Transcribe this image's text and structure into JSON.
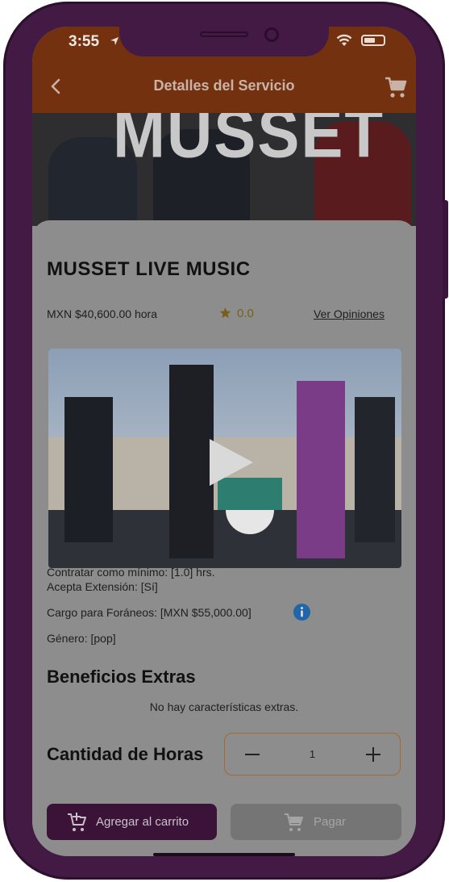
{
  "status_bar": {
    "time": "3:55"
  },
  "header": {
    "title": "Detalles del Servicio"
  },
  "hero": {
    "text": "MUSSET"
  },
  "service": {
    "title": "MUSSET LIVE MUSIC",
    "price": "MXN $40,600.00 hora",
    "rating": "0.0",
    "opinions_link": "Ver Opiniones"
  },
  "details": {
    "min_hire": "Contratar como mínimo: [1.0] hrs.",
    "extension": "Acepta Extensión: [Sí]",
    "foreign_fee": "Cargo para Foráneos: [MXN $55,000.00]",
    "genre": "Género: [pop]"
  },
  "extras": {
    "title": "Beneficios Extras",
    "empty_text": "No hay características extras."
  },
  "hours": {
    "title": "Cantidad de Horas",
    "value": "1"
  },
  "actions": {
    "add_to_cart": "Agregar al carrito",
    "pay": "Pagar"
  },
  "colors": {
    "header_bg": "#733110",
    "frame": "#431a43",
    "primary_button": "#3b1238",
    "overlay": "#8d8d8d"
  },
  "icons": [
    "back-arrow-icon",
    "cart-icon",
    "star-icon",
    "play-icon",
    "info-icon",
    "minus-icon",
    "plus-icon",
    "add-cart-icon"
  ]
}
